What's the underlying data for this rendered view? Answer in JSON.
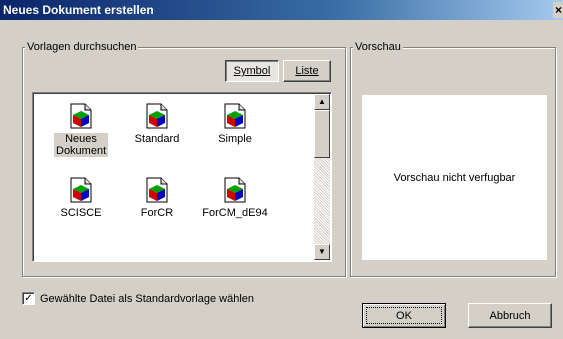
{
  "window": {
    "title": "Neues Dokument erstellen",
    "close_glyph": "×"
  },
  "browse": {
    "group_label": "Vorlagen durchsuchen",
    "view_symbol_label": "Symbol",
    "view_list_label": "Liste",
    "templates": [
      {
        "label": "Neues Dokument",
        "icon": "document-icon",
        "selected": true
      },
      {
        "label": "Standard",
        "icon": "document-icon",
        "selected": false
      },
      {
        "label": "Simple",
        "icon": "document-icon",
        "selected": false
      },
      {
        "label": "SCISCE",
        "icon": "document-icon",
        "selected": false
      },
      {
        "label": "ForCR",
        "icon": "document-icon",
        "selected": false
      },
      {
        "label": "ForCM_dE94",
        "icon": "document-icon",
        "selected": false
      }
    ],
    "scroll_up_glyph": "▲",
    "scroll_down_glyph": "▼"
  },
  "preview": {
    "group_label": "Vorschau",
    "message": "Vorschau nicht verfugbar"
  },
  "options": {
    "checkbox_checked": true,
    "checkbox_mark": "✓",
    "checkbox_label": "Gewählte Datei als Standardvorlage wählen"
  },
  "actions": {
    "ok_label": "OK",
    "cancel_label": "Abbruch"
  }
}
